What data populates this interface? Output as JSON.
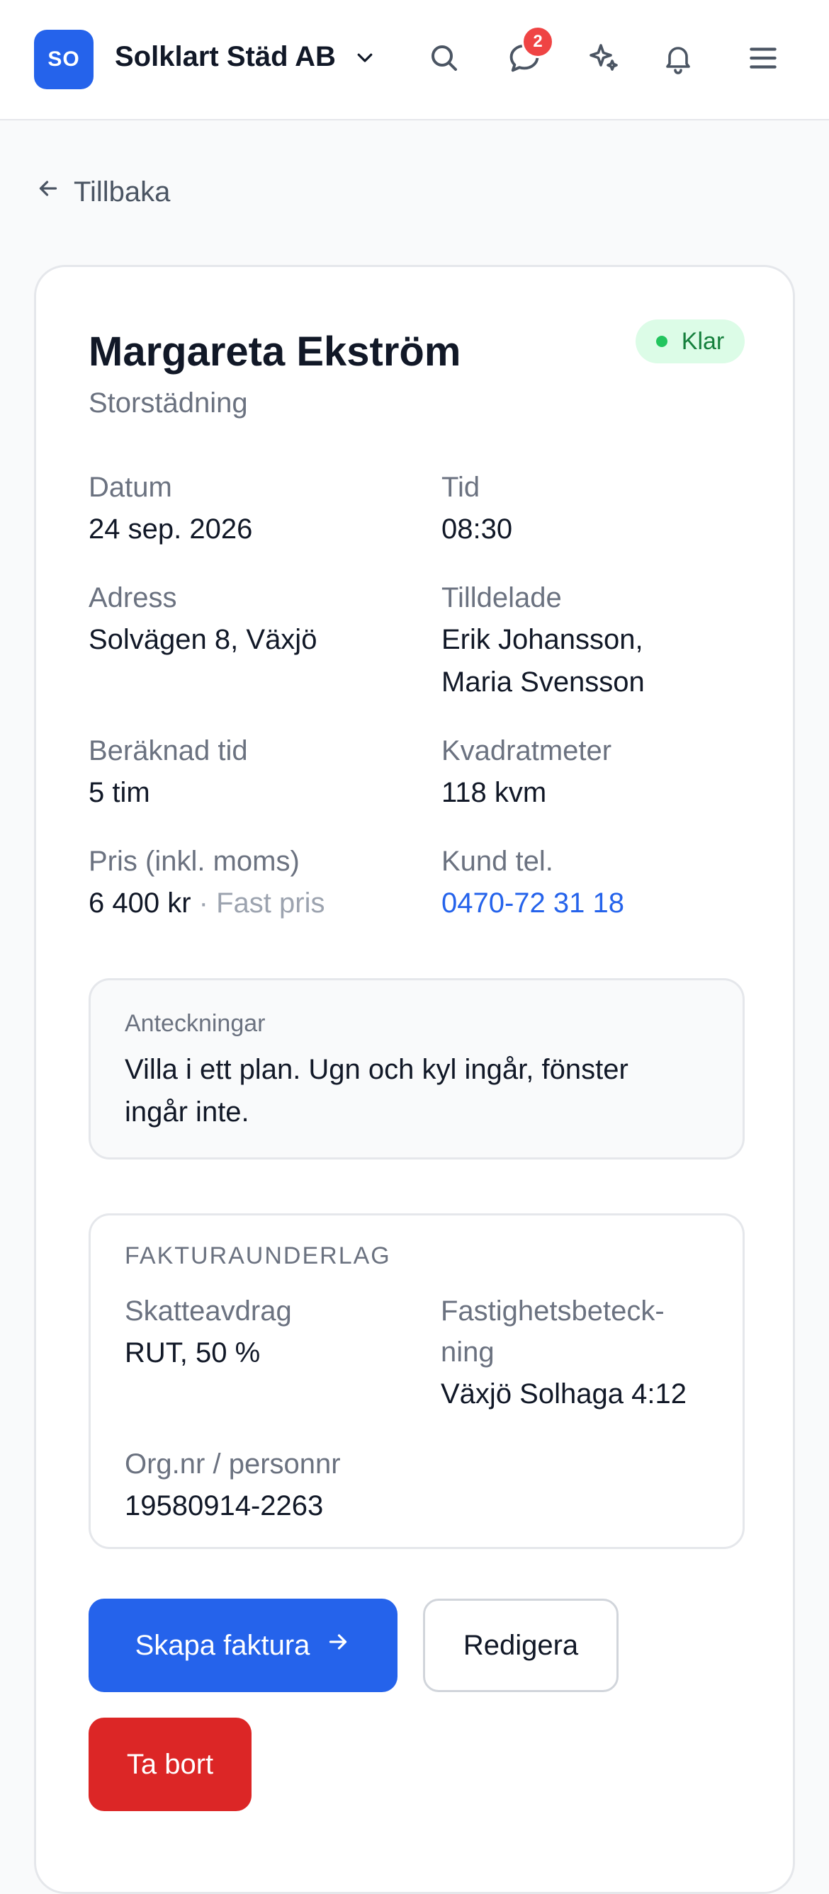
{
  "header": {
    "avatar_initials": "SO",
    "company_name": "Solklart Städ AB",
    "messages_badge": "2",
    "icons": [
      "chevron-down-icon",
      "search-icon",
      "chat-icon",
      "sparkle-icon",
      "bell-icon",
      "menu-icon"
    ],
    "accent_color": "#2563eb"
  },
  "nav": {
    "back_label": "Tillbaka"
  },
  "job": {
    "customer_name": "Margareta Ekström",
    "service": "Storstädning",
    "status": "Klar",
    "status_color": "#22c55e",
    "date_label": "Datum",
    "date_value": "24 sep. 2026",
    "time_label": "Tid",
    "time_value": "08:30",
    "address_label": "Adress",
    "address_value": "Solvägen 8, Växjö",
    "assigned_label": "Tilldelade",
    "assigned_value_1": "Erik Johansson,",
    "assigned_value_2": "Maria Svensson",
    "duration_label": "Beräknad tid",
    "duration_value": "5 tim",
    "area_label": "Kvadratmeter",
    "area_value": "118 kvm",
    "price_label": "Pris (inkl. moms)",
    "price_value": "6 400 kr",
    "price_type": "· Fast pris",
    "phone_label": "Kund tel.",
    "phone_value": "0470-72 31 18"
  },
  "notes": {
    "label": "Anteckningar",
    "line1": "Villa i ett plan. Ugn och kyl ingår, fönster",
    "line2": "ingår inte."
  },
  "invoice": {
    "heading": "FAKTURAUNDERLAG",
    "tax_label": "Skatteavdrag",
    "tax_value": "RUT, 50 %",
    "property_label_1": "Fastighetsbeteck-",
    "property_label_2": "ning",
    "property_value": "Växjö Solhaga 4:12",
    "id_label": "Org.nr / personnr",
    "id_value": "19580914-2263"
  },
  "actions": {
    "create_invoice": "Skapa faktura",
    "edit": "Redigera",
    "delete": "Ta bort"
  }
}
